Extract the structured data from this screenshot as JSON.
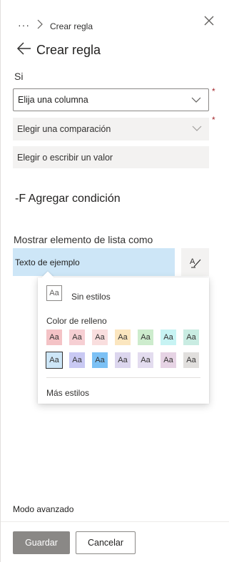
{
  "header": {
    "breadcrumb_dots": "···",
    "breadcrumb_current": "Crear regla",
    "title": "Crear regla",
    "close_icon": "close-icon",
    "back_icon": "back-arrow-icon"
  },
  "condition": {
    "si_label": "Si",
    "column_placeholder": "Elija una columna",
    "comparison_placeholder": "Elegir una comparación",
    "value_placeholder": "Elegir o escribir un valor",
    "required_mark": "*",
    "add_condition": "-F Agregar condición"
  },
  "display": {
    "label": "Mostrar elemento de lista como",
    "preview_text": "Texto de ejemplo",
    "format_icon": "format-painter-icon"
  },
  "style_callout": {
    "no_style_sample": "Aa",
    "no_style_label": "Sin estilos",
    "fill_color_label": "Color de relleno",
    "swatches_row1": [
      {
        "label": "Aa",
        "color": "#f4c3c6"
      },
      {
        "label": "Aa",
        "color": "#f6cfd3"
      },
      {
        "label": "Aa",
        "color": "#f9dede"
      },
      {
        "label": "Aa",
        "color": "#fbe6bf"
      },
      {
        "label": "Aa",
        "color": "#cdeccd"
      },
      {
        "label": "Aa",
        "color": "#c7f3f3"
      },
      {
        "label": "Aa",
        "color": "#c9ece2"
      }
    ],
    "swatches_row2": [
      {
        "label": "Aa",
        "color": "#cde6f7",
        "selected": true
      },
      {
        "label": "Aa",
        "color": "#c9c9f3"
      },
      {
        "label": "Aa",
        "color": "#7cc1f5"
      },
      {
        "label": "Aa",
        "color": "#dcd6ee"
      },
      {
        "label": "Aa",
        "color": "#e3dcef"
      },
      {
        "label": "Aa",
        "color": "#e6d3e4"
      },
      {
        "label": "Aa",
        "color": "#e1dfdd"
      }
    ],
    "more_styles": "Más estilos"
  },
  "footer": {
    "advanced_mode": "Modo avanzado",
    "save": "Guardar",
    "cancel": "Cancelar"
  }
}
